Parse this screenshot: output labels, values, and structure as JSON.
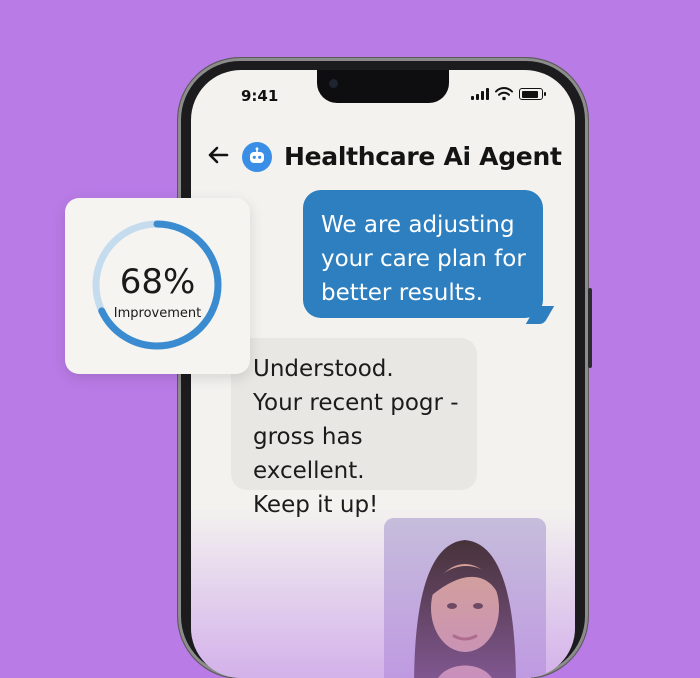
{
  "status_bar": {
    "time": "9:41"
  },
  "chat": {
    "title": "Healthcare Ai Agent",
    "messages": [
      {
        "role": "agent",
        "text": "We are adjusting your care plan for better results."
      },
      {
        "role": "user",
        "text": "Understood.\nYour recent pogr -\ngross has excellent.\nKeep it up!"
      }
    ]
  },
  "stat": {
    "value": "68%",
    "label": "Improvement",
    "progress": 0.68
  },
  "colors": {
    "background": "#b97be6",
    "agent_bubble": "#2e7fbf",
    "accent": "#3a8ee6"
  },
  "icons": {
    "back": "arrow-left-icon",
    "avatar": "robot-icon",
    "signal": "signal-icon",
    "wifi": "wifi-icon",
    "battery": "battery-icon"
  }
}
